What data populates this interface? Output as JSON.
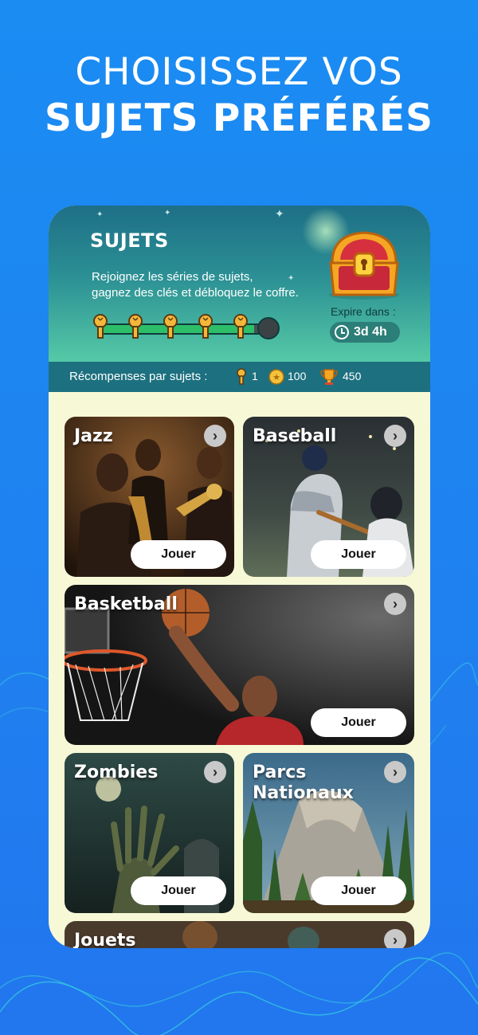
{
  "headline": {
    "line1": "CHOISISSEZ VOS",
    "line2": "SUJETS PRÉFÉRÉS"
  },
  "header": {
    "title": "SUJETS",
    "description_line1": "Rejoignez les séries de sujets,",
    "description_line2": "gagnez des clés et débloquez le coffre.",
    "keys_collected": 5,
    "keys_total": 6,
    "expire_label": "Expire dans :",
    "expire_value": "3d 4h"
  },
  "rewards": {
    "label": "Récompenses par sujets :",
    "keys": "1",
    "coins": "100",
    "trophies": "450"
  },
  "topics": [
    {
      "name": "Jazz",
      "play": "Jouer"
    },
    {
      "name": "Baseball",
      "play": "Jouer"
    },
    {
      "name": "Basketball",
      "play": "Jouer"
    },
    {
      "name": "Zombies",
      "play": "Jouer"
    },
    {
      "name_line1": "Parcs",
      "name_line2": "Nationaux",
      "play": "Jouer"
    },
    {
      "name": "Jouets"
    }
  ],
  "colors": {
    "background": "#1E84F0",
    "header_teal": "#2B8F94",
    "rewards_bar": "#1D707F",
    "panel": "#F7F8D6",
    "progress": "#2EBE6A"
  },
  "icons": [
    "key-icon",
    "coin-icon",
    "trophy-icon",
    "clock-icon",
    "chevron-right-icon",
    "treasure-chest-icon"
  ]
}
